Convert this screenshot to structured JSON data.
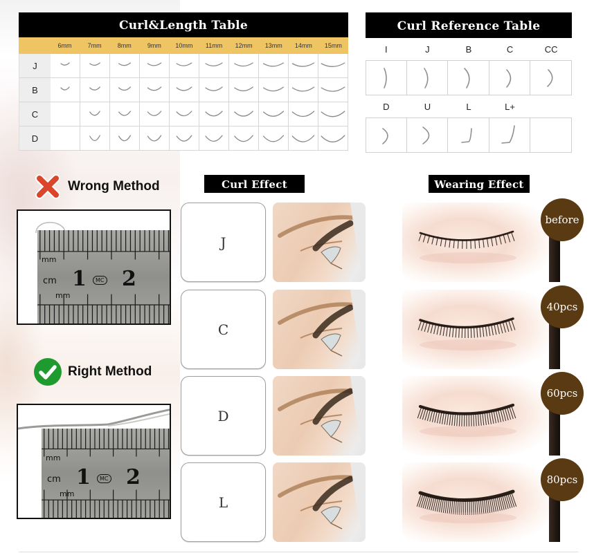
{
  "curl_length_table": {
    "title": "Curl&Length Table",
    "lengths": [
      "6mm",
      "7mm",
      "8mm",
      "9mm",
      "10mm",
      "11mm",
      "12mm",
      "13mm",
      "14mm",
      "15mm"
    ],
    "rows": [
      {
        "curl": "J",
        "available": [
          true,
          true,
          true,
          true,
          true,
          true,
          true,
          true,
          true,
          true
        ]
      },
      {
        "curl": "B",
        "available": [
          true,
          true,
          true,
          true,
          true,
          true,
          true,
          true,
          true,
          true
        ]
      },
      {
        "curl": "C",
        "available": [
          false,
          true,
          true,
          true,
          true,
          true,
          true,
          true,
          true,
          true
        ]
      },
      {
        "curl": "D",
        "available": [
          false,
          true,
          true,
          true,
          true,
          true,
          true,
          true,
          true,
          true
        ]
      }
    ],
    "colors": {
      "title_bg": "#000000",
      "header_bg": "#efc463",
      "label_bg": "#eeeeee"
    }
  },
  "curl_reference_table": {
    "title": "Curl Reference Table",
    "row1": [
      {
        "label": "I",
        "icon": "i-curl-icon"
      },
      {
        "label": "J",
        "icon": "j-curl-icon"
      },
      {
        "label": "B",
        "icon": "b-curl-icon"
      },
      {
        "label": "C",
        "icon": "c-curl-icon"
      },
      {
        "label": "CC",
        "icon": "cc-curl-icon"
      }
    ],
    "row2": [
      {
        "label": "D",
        "icon": "d-curl-icon"
      },
      {
        "label": "U",
        "icon": "u-curl-icon"
      },
      {
        "label": "L",
        "icon": "l-curl-icon"
      },
      {
        "label": "L+",
        "icon": "l-plus-curl-icon"
      },
      {
        "label": "",
        "icon": ""
      }
    ]
  },
  "methods": {
    "wrong": {
      "label": "Wrong Method",
      "icon": "red-x-icon",
      "color": "#d9462b"
    },
    "right": {
      "label": "Right Method",
      "icon": "green-check-icon",
      "color": "#1f9a2e"
    },
    "ruler": {
      "unit_top": "mm",
      "unit_cm": "cm",
      "unit_bottom": "mm",
      "num1": "1",
      "num2": "2",
      "mark": "MC"
    }
  },
  "curl_effect": {
    "title": "Curl Effect",
    "items": [
      {
        "curl": "J",
        "photo": "side-eye-j-curl"
      },
      {
        "curl": "C",
        "photo": "side-eye-c-curl"
      },
      {
        "curl": "D",
        "photo": "side-eye-d-curl"
      },
      {
        "curl": "L",
        "photo": "side-eye-l-curl"
      }
    ]
  },
  "wearing_effect": {
    "title": "Wearing Effect",
    "items": [
      {
        "label": "before",
        "lash_density": 0.25
      },
      {
        "label": "40pcs",
        "lash_density": 0.5
      },
      {
        "label": "60pcs",
        "lash_density": 0.75
      },
      {
        "label": "80pcs",
        "lash_density": 1.0
      }
    ],
    "badge_color": "#5a3a12"
  }
}
